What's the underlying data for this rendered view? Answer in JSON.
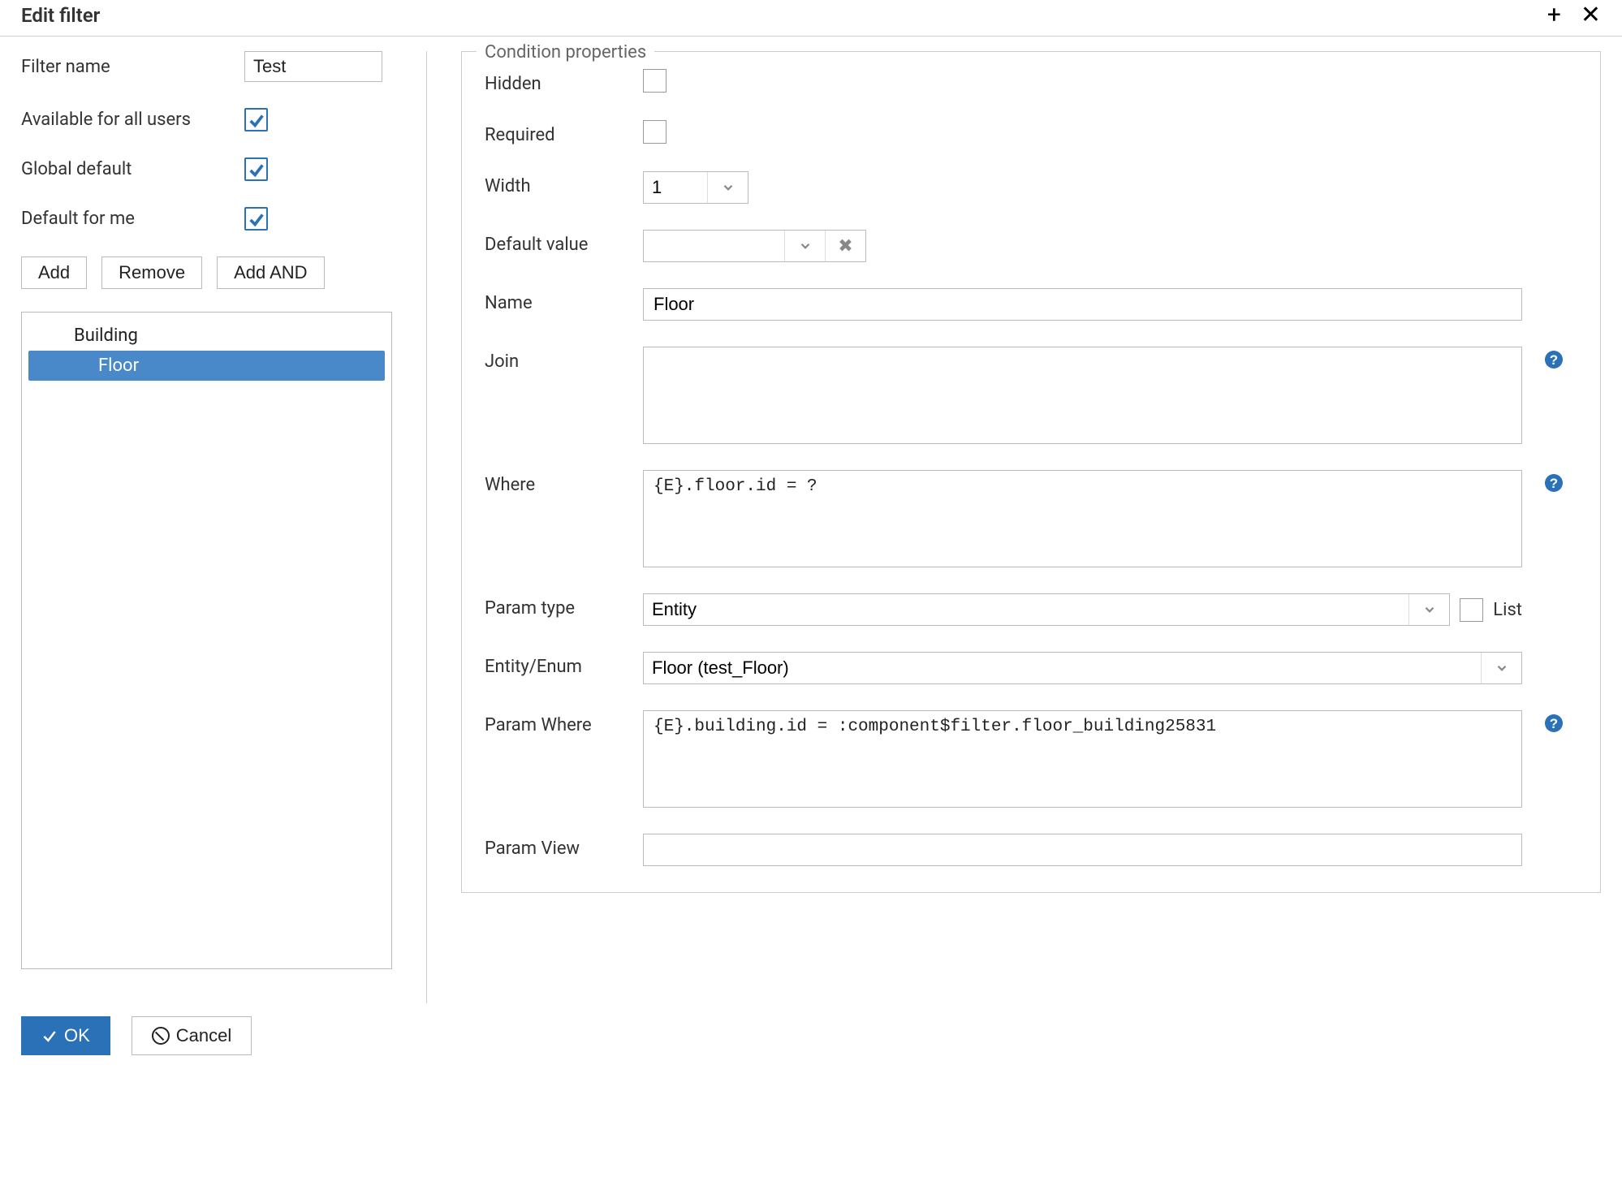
{
  "title": "Edit filter",
  "left": {
    "filter_name_label": "Filter name",
    "filter_name_value": "Test",
    "available_label": "Available for all users",
    "available_checked": true,
    "global_default_label": "Global default",
    "global_default_checked": true,
    "default_me_label": "Default for me",
    "default_me_checked": true,
    "buttons": {
      "add": "Add",
      "remove": "Remove",
      "add_and": "Add AND"
    },
    "tree": {
      "items": [
        {
          "label": "Building",
          "level": 1,
          "selected": false
        },
        {
          "label": "Floor",
          "level": 2,
          "selected": true
        }
      ]
    }
  },
  "cond": {
    "legend": "Condition properties",
    "hidden_label": "Hidden",
    "hidden_checked": false,
    "required_label": "Required",
    "required_checked": false,
    "width_label": "Width",
    "width_value": "1",
    "defval_label": "Default value",
    "defval_value": "",
    "name_label": "Name",
    "name_value": "Floor",
    "join_label": "Join",
    "join_value": "",
    "where_label": "Where",
    "where_value": "{E}.floor.id = ?",
    "ptype_label": "Param type",
    "ptype_value": "Entity",
    "list_label": "List",
    "list_checked": false,
    "entity_label": "Entity/Enum",
    "entity_value": "Floor (test_Floor)",
    "pwhere_label": "Param Where",
    "pwhere_value": "{E}.building.id = :component$filter.floor_building25831",
    "pview_label": "Param View",
    "pview_value": ""
  },
  "footer": {
    "ok": "OK",
    "cancel": "Cancel"
  }
}
